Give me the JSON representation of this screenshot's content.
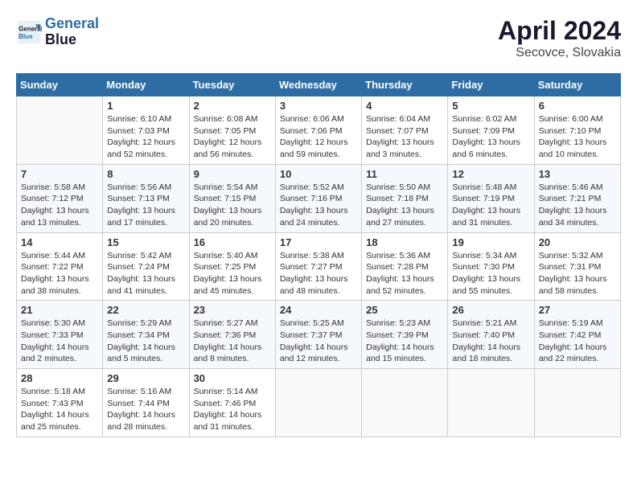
{
  "header": {
    "logo_line1": "General",
    "logo_line2": "Blue",
    "month": "April 2024",
    "location": "Secovce, Slovakia"
  },
  "days_of_week": [
    "Sunday",
    "Monday",
    "Tuesday",
    "Wednesday",
    "Thursday",
    "Friday",
    "Saturday"
  ],
  "weeks": [
    [
      {
        "day": "",
        "info": ""
      },
      {
        "day": "1",
        "info": "Sunrise: 6:10 AM\nSunset: 7:03 PM\nDaylight: 12 hours\nand 52 minutes."
      },
      {
        "day": "2",
        "info": "Sunrise: 6:08 AM\nSunset: 7:05 PM\nDaylight: 12 hours\nand 56 minutes."
      },
      {
        "day": "3",
        "info": "Sunrise: 6:06 AM\nSunset: 7:06 PM\nDaylight: 12 hours\nand 59 minutes."
      },
      {
        "day": "4",
        "info": "Sunrise: 6:04 AM\nSunset: 7:07 PM\nDaylight: 13 hours\nand 3 minutes."
      },
      {
        "day": "5",
        "info": "Sunrise: 6:02 AM\nSunset: 7:09 PM\nDaylight: 13 hours\nand 6 minutes."
      },
      {
        "day": "6",
        "info": "Sunrise: 6:00 AM\nSunset: 7:10 PM\nDaylight: 13 hours\nand 10 minutes."
      }
    ],
    [
      {
        "day": "7",
        "info": "Sunrise: 5:58 AM\nSunset: 7:12 PM\nDaylight: 13 hours\nand 13 minutes."
      },
      {
        "day": "8",
        "info": "Sunrise: 5:56 AM\nSunset: 7:13 PM\nDaylight: 13 hours\nand 17 minutes."
      },
      {
        "day": "9",
        "info": "Sunrise: 5:54 AM\nSunset: 7:15 PM\nDaylight: 13 hours\nand 20 minutes."
      },
      {
        "day": "10",
        "info": "Sunrise: 5:52 AM\nSunset: 7:16 PM\nDaylight: 13 hours\nand 24 minutes."
      },
      {
        "day": "11",
        "info": "Sunrise: 5:50 AM\nSunset: 7:18 PM\nDaylight: 13 hours\nand 27 minutes."
      },
      {
        "day": "12",
        "info": "Sunrise: 5:48 AM\nSunset: 7:19 PM\nDaylight: 13 hours\nand 31 minutes."
      },
      {
        "day": "13",
        "info": "Sunrise: 5:46 AM\nSunset: 7:21 PM\nDaylight: 13 hours\nand 34 minutes."
      }
    ],
    [
      {
        "day": "14",
        "info": "Sunrise: 5:44 AM\nSunset: 7:22 PM\nDaylight: 13 hours\nand 38 minutes."
      },
      {
        "day": "15",
        "info": "Sunrise: 5:42 AM\nSunset: 7:24 PM\nDaylight: 13 hours\nand 41 minutes."
      },
      {
        "day": "16",
        "info": "Sunrise: 5:40 AM\nSunset: 7:25 PM\nDaylight: 13 hours\nand 45 minutes."
      },
      {
        "day": "17",
        "info": "Sunrise: 5:38 AM\nSunset: 7:27 PM\nDaylight: 13 hours\nand 48 minutes."
      },
      {
        "day": "18",
        "info": "Sunrise: 5:36 AM\nSunset: 7:28 PM\nDaylight: 13 hours\nand 52 minutes."
      },
      {
        "day": "19",
        "info": "Sunrise: 5:34 AM\nSunset: 7:30 PM\nDaylight: 13 hours\nand 55 minutes."
      },
      {
        "day": "20",
        "info": "Sunrise: 5:32 AM\nSunset: 7:31 PM\nDaylight: 13 hours\nand 58 minutes."
      }
    ],
    [
      {
        "day": "21",
        "info": "Sunrise: 5:30 AM\nSunset: 7:33 PM\nDaylight: 14 hours\nand 2 minutes."
      },
      {
        "day": "22",
        "info": "Sunrise: 5:29 AM\nSunset: 7:34 PM\nDaylight: 14 hours\nand 5 minutes."
      },
      {
        "day": "23",
        "info": "Sunrise: 5:27 AM\nSunset: 7:36 PM\nDaylight: 14 hours\nand 8 minutes."
      },
      {
        "day": "24",
        "info": "Sunrise: 5:25 AM\nSunset: 7:37 PM\nDaylight: 14 hours\nand 12 minutes."
      },
      {
        "day": "25",
        "info": "Sunrise: 5:23 AM\nSunset: 7:39 PM\nDaylight: 14 hours\nand 15 minutes."
      },
      {
        "day": "26",
        "info": "Sunrise: 5:21 AM\nSunset: 7:40 PM\nDaylight: 14 hours\nand 18 minutes."
      },
      {
        "day": "27",
        "info": "Sunrise: 5:19 AM\nSunset: 7:42 PM\nDaylight: 14 hours\nand 22 minutes."
      }
    ],
    [
      {
        "day": "28",
        "info": "Sunrise: 5:18 AM\nSunset: 7:43 PM\nDaylight: 14 hours\nand 25 minutes."
      },
      {
        "day": "29",
        "info": "Sunrise: 5:16 AM\nSunset: 7:44 PM\nDaylight: 14 hours\nand 28 minutes."
      },
      {
        "day": "30",
        "info": "Sunrise: 5:14 AM\nSunset: 7:46 PM\nDaylight: 14 hours\nand 31 minutes."
      },
      {
        "day": "",
        "info": ""
      },
      {
        "day": "",
        "info": ""
      },
      {
        "day": "",
        "info": ""
      },
      {
        "day": "",
        "info": ""
      }
    ]
  ]
}
